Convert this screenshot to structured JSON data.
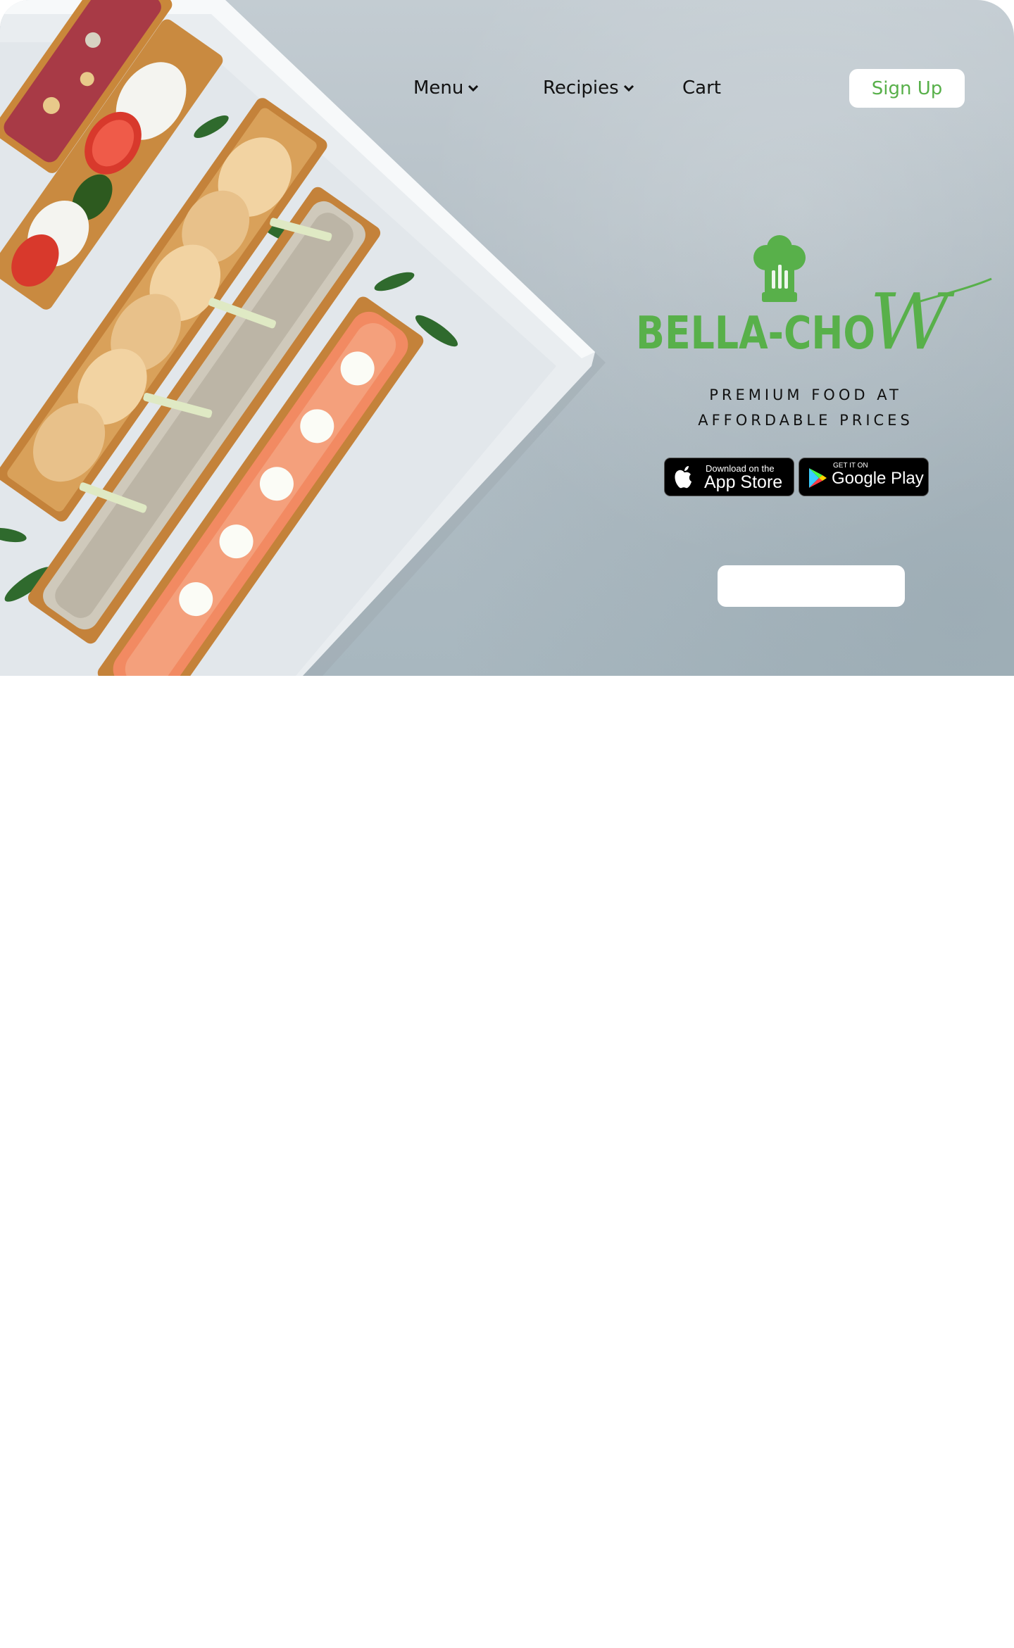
{
  "nav": {
    "menu_label": "Menu",
    "recipes_label": "Recipies",
    "cart_label": "Cart",
    "signup_label": "Sign Up"
  },
  "brand": {
    "name": "BELLA-CHOW",
    "accent_color": "#58b04a"
  },
  "tagline": {
    "line1": "PREMIUM FOOD AT",
    "line2": "AFFORDABLE PRICES"
  },
  "app_store": {
    "small": "Download on the",
    "big": "App Store",
    "icon": "apple-icon"
  },
  "google_play": {
    "small": "GET IT ON",
    "big": "Google Play",
    "icon": "google-play-icon"
  }
}
